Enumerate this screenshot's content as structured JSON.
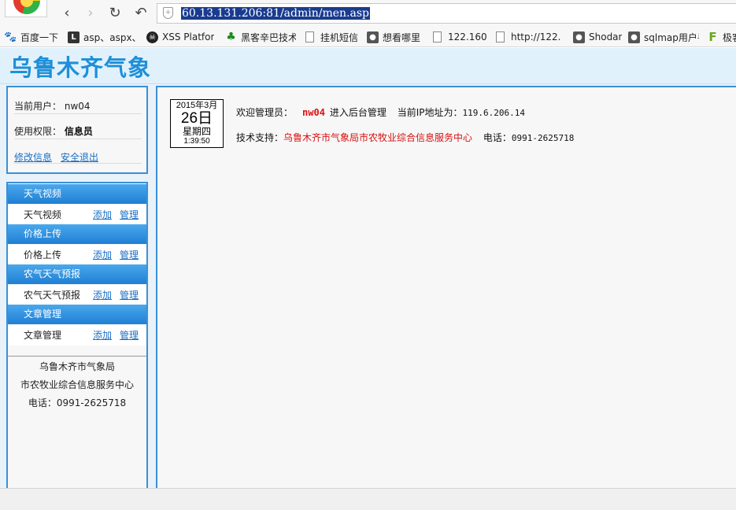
{
  "browser": {
    "url": "60.13.131.206:81/admin/men.asp",
    "nav": {
      "back": "‹",
      "forward": "›",
      "reload": "↻",
      "undo": "↶"
    },
    "bookmarks": [
      {
        "label": "百度一下",
        "icon": "paw-icon"
      },
      {
        "label": "asp、aspx、",
        "icon": "letter-l-icon"
      },
      {
        "label": "XSS Platfor",
        "icon": "skull-icon"
      },
      {
        "label": "黑客辛巴技术",
        "icon": "tree-icon"
      },
      {
        "label": "挂机短信",
        "icon": "page-icon"
      },
      {
        "label": "想看哪里",
        "icon": "penguin-icon"
      },
      {
        "label": "122.160.",
        "icon": "page-icon"
      },
      {
        "label": "http://122.",
        "icon": "page-icon"
      },
      {
        "label": "Shodan",
        "icon": "penguin-icon"
      },
      {
        "label": "sqlmap用户手",
        "icon": "penguin-icon"
      },
      {
        "label": "极客",
        "icon": "letter-f-icon"
      }
    ]
  },
  "header": {
    "title": "乌鲁木齐气象"
  },
  "user": {
    "current_label": "当前用户：",
    "current_value": "nw04",
    "role_label": "使用权限：",
    "role_value": "信息员",
    "edit_link": "修改信息",
    "logout_link": "安全退出"
  },
  "menu": {
    "sections": [
      {
        "title": "天气视频",
        "item": "天气视频",
        "add": "添加",
        "manage": "管理"
      },
      {
        "title": "价格上传",
        "item": "价格上传",
        "add": "添加",
        "manage": "管理"
      },
      {
        "title": "农气天气预报",
        "item": "农气天气预报",
        "add": "添加",
        "manage": "管理"
      },
      {
        "title": "文章管理",
        "item": "文章管理",
        "add": "添加",
        "manage": "管理"
      }
    ]
  },
  "org": {
    "line1": "乌鲁木齐市气象局",
    "line2": "市农牧业综合信息服务中心",
    "line3": "电话：0991-2625718"
  },
  "date": {
    "year_month": "2015年3月",
    "day": "26日",
    "weekday": "星期四",
    "time": "1:39:50"
  },
  "welcome": {
    "label": "欢迎管理员：",
    "user": "nw04",
    "after": "进入后台管理",
    "ip_label": "当前IP地址为：",
    "ip": "119.6.206.14"
  },
  "support": {
    "label": "技术支持：",
    "org": "乌鲁木齐市气象局市农牧业综合信息服务中心",
    "phone_label": "电话：",
    "phone": "0991-2625718"
  }
}
